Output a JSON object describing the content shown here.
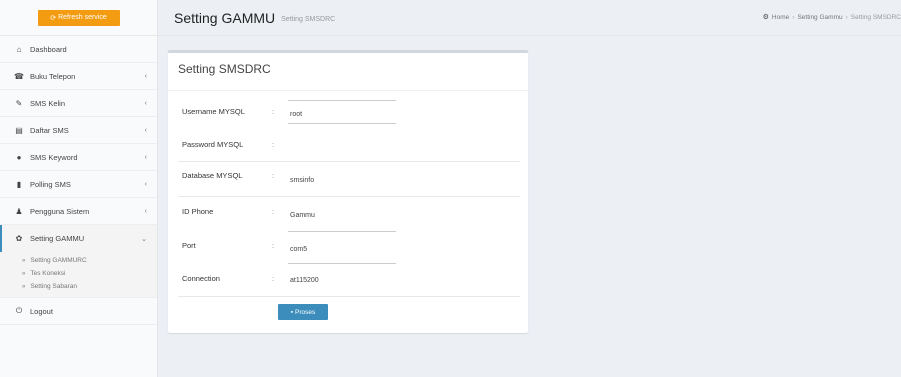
{
  "sidebar": {
    "refresh_label": "Refresh service",
    "items": [
      {
        "label": "Dashboard",
        "icon": "home-icon",
        "glyph": "⌂",
        "chevron": ""
      },
      {
        "label": "Buku Telepon",
        "icon": "phone-book-icon",
        "glyph": "☎",
        "chevron": "‹"
      },
      {
        "label": "SMS Kelin",
        "icon": "edit-icon",
        "glyph": "✎",
        "chevron": "‹"
      },
      {
        "label": "Daftar SMS",
        "icon": "list-icon",
        "glyph": "▤",
        "chevron": "‹"
      },
      {
        "label": "SMS Keyword",
        "icon": "tag-icon",
        "glyph": "●",
        "chevron": "‹"
      },
      {
        "label": "Polling SMS",
        "icon": "bar-chart-icon",
        "glyph": "▮",
        "chevron": "‹"
      },
      {
        "label": "Pengguna Sistem",
        "icon": "user-icon",
        "glyph": "♟",
        "chevron": "‹"
      }
    ],
    "active": {
      "label": "Setting GAMMU",
      "icon": "gear-icon",
      "glyph": "✿",
      "chevron": "⌄"
    },
    "submenu": [
      "Setting GAMMURC",
      "Tes Koneksi",
      "Setting Sabaran"
    ],
    "logout": {
      "label": "Logout",
      "glyph": "⏻"
    }
  },
  "header": {
    "title": "Setting GAMMU",
    "subtitle": "Setting SMSDRC",
    "breadcrumb": [
      "Home",
      "Setting Gammu",
      "Setting SMSDRC"
    ]
  },
  "form": {
    "title": "Setting SMSDRC",
    "fields": {
      "username": {
        "label": "Username MYSQL",
        "value": "root"
      },
      "password": {
        "label": "Password MYSQL",
        "value": ""
      },
      "database": {
        "label": "Database MYSQL",
        "value": "smsinfo"
      },
      "phone_id": {
        "label": "ID Phone",
        "value": "Gammu"
      },
      "port": {
        "label": "Port",
        "value": "com5"
      },
      "connection": {
        "label": "Connection",
        "value": "at115200"
      }
    },
    "colon": ":",
    "submit_label": "Proses"
  },
  "colors": {
    "accent": "#3c8dbc",
    "warning": "#f39c12",
    "background": "#ecf0f5"
  }
}
